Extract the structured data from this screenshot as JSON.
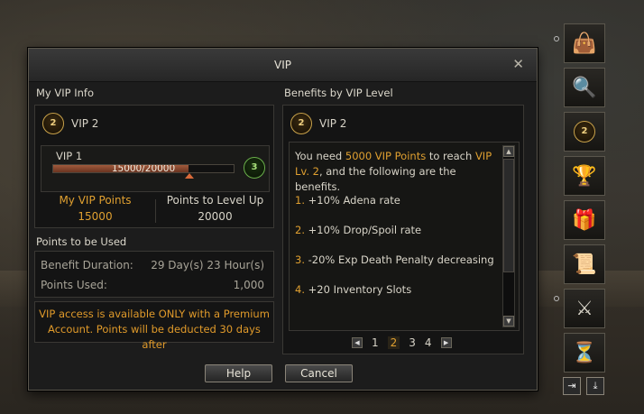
{
  "window": {
    "title": "VIP"
  },
  "my_vip": {
    "section_label": "My VIP Info",
    "level_badge": "2",
    "level_label": "VIP 2",
    "progress": {
      "current_label": "VIP 1",
      "text": "15000/20000",
      "fraction": 0.75,
      "next_badge": "3"
    },
    "points_label": "My VIP Points",
    "points_value": "15000",
    "to_level_label": "Points to Level Up",
    "to_level_value": "20000"
  },
  "points_used": {
    "section_label": "Points to be Used",
    "rows": [
      {
        "label": "Benefit Duration:",
        "value": "29 Day(s) 23 Hour(s)"
      },
      {
        "label": "Points Used:",
        "value": "1,000"
      }
    ],
    "notice_line1": "VIP access is available ONLY with a Premium",
    "notice_line2": "Account. Points will be deducted 30 days after"
  },
  "benefits": {
    "section_label": "Benefits by VIP Level",
    "level_badge": "2",
    "level_label": "VIP 2",
    "intro_a": "You need ",
    "intro_points": "5000 VIP Points",
    "intro_b": " to reach ",
    "intro_level_1": "VIP",
    "intro_level_2": "Lv. 2",
    "intro_c": ", and the following are the benefits.",
    "items": [
      {
        "num": "1.",
        "text": "+10% Adena rate"
      },
      {
        "num": "2.",
        "text": "+10% Drop/Spoil rate"
      },
      {
        "num": "3.",
        "text": "-20% Exp Death Penalty decreasing"
      },
      {
        "num": "4.",
        "text": "+20 Inventory Slots"
      }
    ]
  },
  "pager": {
    "pages": [
      "1",
      "2",
      "3",
      "4"
    ],
    "active": "2"
  },
  "buttons": {
    "help": "Help",
    "cancel": "Cancel"
  },
  "sidebar": {
    "icons": [
      "shopping-bag-icon",
      "magnifier-icon",
      "vip-badge-icon",
      "trophy-icon",
      "gift-box-icon",
      "scroll-icon",
      "crossed-swords-icon",
      "hourglass-icon"
    ],
    "vip_badge": "2"
  },
  "colors": {
    "accent": "#e0a030",
    "panel": "#141414",
    "frame": "#5a564c"
  }
}
